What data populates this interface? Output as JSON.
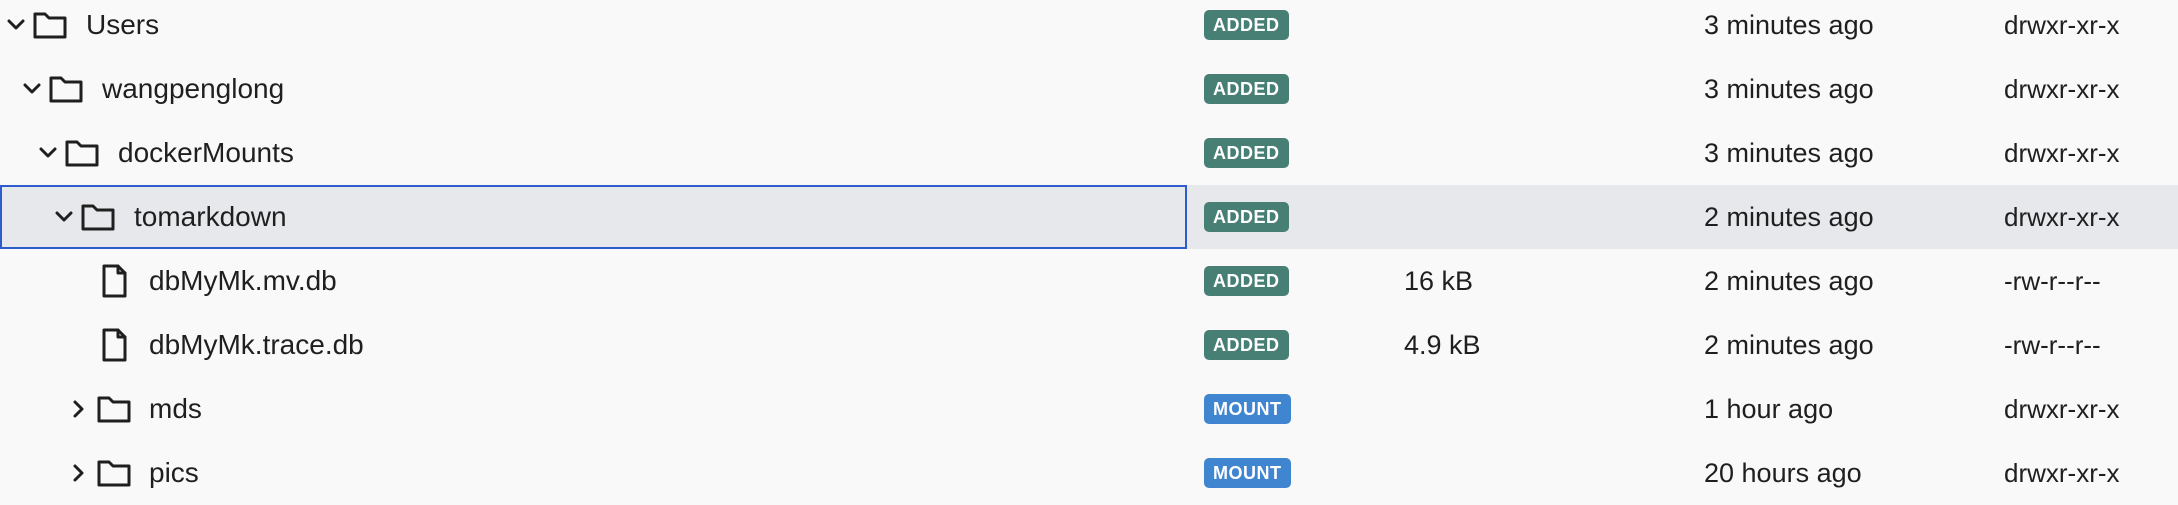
{
  "rows": [
    {
      "name": "Users",
      "type": "folder",
      "expanded": true,
      "status": "ADDED",
      "size": "",
      "modified": "3 minutes ago",
      "permissions": "drwxr-xr-x"
    },
    {
      "name": "wangpenglong",
      "type": "folder",
      "expanded": true,
      "status": "ADDED",
      "size": "",
      "modified": "3 minutes ago",
      "permissions": "drwxr-xr-x"
    },
    {
      "name": "dockerMounts",
      "type": "folder",
      "expanded": true,
      "status": "ADDED",
      "size": "",
      "modified": "3 minutes ago",
      "permissions": "drwxr-xr-x"
    },
    {
      "name": "tomarkdown",
      "type": "folder",
      "expanded": true,
      "selected": true,
      "status": "ADDED",
      "size": "",
      "modified": "2 minutes ago",
      "permissions": "drwxr-xr-x"
    },
    {
      "name": "dbMyMk.mv.db",
      "type": "file",
      "status": "ADDED",
      "size": "16 kB",
      "modified": "2 minutes ago",
      "permissions": "-rw-r--r--"
    },
    {
      "name": "dbMyMk.trace.db",
      "type": "file",
      "status": "ADDED",
      "size": "4.9 kB",
      "modified": "2 minutes ago",
      "permissions": "-rw-r--r--"
    },
    {
      "name": "mds",
      "type": "folder",
      "expanded": false,
      "status": "MOUNT",
      "size": "",
      "modified": "1 hour ago",
      "permissions": "drwxr-xr-x"
    },
    {
      "name": "pics",
      "type": "folder",
      "expanded": false,
      "status": "MOUNT",
      "size": "",
      "modified": "20 hours ago",
      "permissions": "drwxr-xr-x"
    }
  ],
  "icons": {
    "expanded_folder": "chevron-down-icon",
    "collapsed_folder": "chevron-right-icon",
    "folder": "folder-icon",
    "file": "file-icon"
  },
  "colors": {
    "added_badge": "#487f74",
    "mount_badge": "#3f85d0",
    "selected_row_background": "#e7e8ec",
    "selected_row_border": "#2f5ccd"
  }
}
